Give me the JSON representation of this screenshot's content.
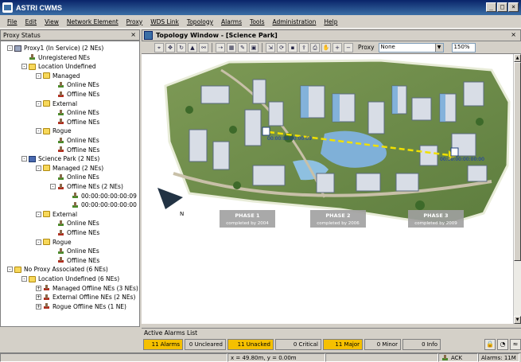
{
  "window": {
    "title": "ASTRI CWMS"
  },
  "menu": [
    "File",
    "Edit",
    "View",
    "Network Element",
    "Proxy",
    "WDS Link",
    "Topology",
    "Alarms",
    "Tools",
    "Administration",
    "Help"
  ],
  "proxy_panel": {
    "title": "Proxy Status"
  },
  "tree": [
    {
      "label": "Proxy1 (In Service) (2 NEs)",
      "icon": "pc-icon",
      "tog": "-"
    },
    {
      "label": "Unregistered NEs",
      "icon": "ne-icon"
    },
    {
      "label": "Location Undefined",
      "icon": "folder-icon",
      "tog": "-"
    },
    {
      "label": "Managed",
      "icon": "folder-icon",
      "tog": "-"
    },
    {
      "label": "Online NEs",
      "icon": "ne-icon"
    },
    {
      "label": "Offline NEs",
      "icon": "ne-offline-icon"
    },
    {
      "label": "External",
      "icon": "folder-icon",
      "tog": "-"
    },
    {
      "label": "Online NEs",
      "icon": "ne-icon"
    },
    {
      "label": "Offline NEs",
      "icon": "ne-offline-icon"
    },
    {
      "label": "Rogue",
      "icon": "folder-icon",
      "tog": "-"
    },
    {
      "label": "Online NEs",
      "icon": "ne-icon"
    },
    {
      "label": "Offline NEs",
      "icon": "ne-offline-icon"
    },
    {
      "label": "Science Park (2 NEs)",
      "icon": "network-icon",
      "tog": "-"
    },
    {
      "label": "Managed (2 NEs)",
      "icon": "folder-icon",
      "tog": "-"
    },
    {
      "label": "Online NEs",
      "icon": "ne-icon"
    },
    {
      "label": "Offline NEs (2 NEs)",
      "icon": "ne-offline-icon",
      "tog": "-"
    },
    {
      "label": "00:00:00:00:00:09",
      "icon": "ne-icon"
    },
    {
      "label": "00:00:00:00:00:00",
      "icon": "ne-icon"
    },
    {
      "label": "External",
      "icon": "folder-icon",
      "tog": "-"
    },
    {
      "label": "Online NEs",
      "icon": "ne-icon"
    },
    {
      "label": "Offline NEs",
      "icon": "ne-offline-icon"
    },
    {
      "label": "Rogue",
      "icon": "folder-icon",
      "tog": "-"
    },
    {
      "label": "Online NEs",
      "icon": "ne-icon"
    },
    {
      "label": "Offline NEs",
      "icon": "ne-offline-icon"
    },
    {
      "label": "No Proxy Associated (6 NEs)",
      "icon": "folder-icon",
      "tog": "-"
    },
    {
      "label": "Location Undefined (6 NEs)",
      "icon": "folder-icon",
      "tog": "-"
    },
    {
      "label": "Managed Offline NEs (3 NEs)",
      "icon": "ne-offline-icon",
      "tog": "+"
    },
    {
      "label": "External Offline NEs (2 NEs)",
      "icon": "ne-offline-icon",
      "tog": "+"
    },
    {
      "label": "Rogue Offline NEs (1 NE)",
      "icon": "ne-offline-icon",
      "tog": "+"
    }
  ],
  "topology": {
    "title": "Topology Window - [Science Park]",
    "proxy_label": "Proxy",
    "proxy_value": "None",
    "zoom": "150%",
    "nodes": [
      "00:00:00:00:00:09",
      "00:00:00:00:00:00"
    ],
    "phases": [
      {
        "name": "PHASE 1",
        "sub": "completed by 2004"
      },
      {
        "name": "PHASE 2",
        "sub": "completed by 2006"
      },
      {
        "name": "PHASE 3",
        "sub": "completed by 2009"
      }
    ],
    "compass": "N"
  },
  "alarms": {
    "title": "Active Alarms List",
    "counts": [
      {
        "label": "11 Alarms",
        "highlight": true
      },
      {
        "label": "0 Uncleared",
        "highlight": false
      },
      {
        "label": "11 Unacked",
        "highlight": true
      },
      {
        "label": "0 Critical",
        "highlight": false
      },
      {
        "label": "11 Major",
        "highlight": true
      },
      {
        "label": "0 Minor",
        "highlight": false
      },
      {
        "label": "0 Info",
        "highlight": false
      }
    ]
  },
  "status": {
    "coords": "x = 49.80m, y = 0.00m",
    "ack": "ACK",
    "alarms": "Alarms: 11M"
  },
  "colors": {
    "titlebar": "#0a246a",
    "alarm_highlight": "#f5c000",
    "map_water": "#7fb0d8",
    "link": "#f0e000"
  }
}
